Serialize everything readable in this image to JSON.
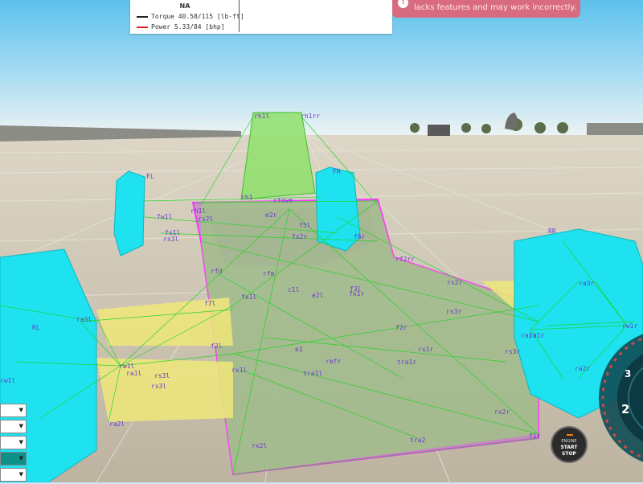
{
  "graph_panel": {
    "title": "NA",
    "series": [
      {
        "label": "Torque 40.58/115 [lb-ft]",
        "color": "#222222"
      },
      {
        "label": "Power  5.33/84   [bhp]",
        "color": "#e02020"
      }
    ]
  },
  "warning": {
    "icon": "info-icon",
    "text": "lacks features and may work incorrectly."
  },
  "engine_button": {
    "line1": "ENGINE",
    "line2": "START",
    "line3": "STOP"
  },
  "gauge": {
    "gear_top": "3",
    "gear_main": "2"
  },
  "node_labels": [
    "rh1l",
    "rh1rr",
    "FL",
    "fw1l",
    "fs1l",
    "rs3l",
    "rh1l",
    "rfdvm",
    "rh1",
    "e2r",
    "FR",
    "RR",
    "rs2l",
    "f5l",
    "f6r",
    "rf2rr",
    "rfm",
    "c1l",
    "f3l",
    "rfd",
    "fx2r",
    "fx1l",
    "f7l",
    "f2l",
    "RL",
    "ra3l",
    "rw1l",
    "ra1l",
    "rs3l",
    "ra2l",
    "rw1l",
    "rx2l",
    "rs3l",
    "tra1l",
    "refr",
    "tra1r",
    "rx1r",
    "rs3r",
    "ra1r",
    "rx2r",
    "f1r",
    "tra2",
    "rs3r",
    "ra3r",
    "rw1r",
    "ra2r",
    "e1",
    "e2l",
    "rx1l",
    "rs2r",
    "fx1r",
    "f2r",
    "ra1r"
  ],
  "colors": {
    "sky_top": "#5cc1ec",
    "sky_bottom": "#e6f0f3",
    "ground": "#cfc6b4",
    "wheel_cyan": "#19e3f0",
    "chassis_green": "#7be05c",
    "chassis_magenta": "#c880c8",
    "suspension_yellow": "#e7e27a",
    "beam_green": "#24d12a",
    "label_purple": "#6a3dc8"
  }
}
